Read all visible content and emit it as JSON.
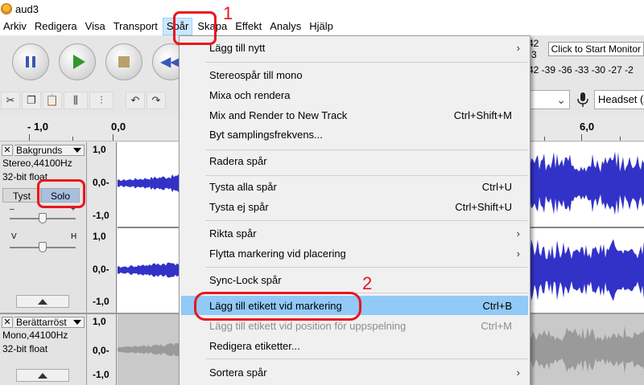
{
  "window": {
    "title": "aud3"
  },
  "menubar": {
    "items": [
      "Arkiv",
      "Redigera",
      "Visa",
      "Transport",
      "Spår",
      "Skapa",
      "Effekt",
      "Analys",
      "Hjälp"
    ]
  },
  "toolbar": {
    "meter_row1": "42 -3",
    "monitor_label": "Click to Start Monitor",
    "meter_row2": "42 -39 -36 -33 -30 -27 -2",
    "playback_device": "Headset (A"
  },
  "ruler": {
    "labels": [
      "- 1,0",
      "0,0",
      "6,0"
    ]
  },
  "tracks": [
    {
      "name": "Bakgrunds",
      "info_line1": "Stereo,44100Hz",
      "info_line2": "32-bit float",
      "mute_label": "Tyst",
      "solo_label": "Solo",
      "gain_minus": "–",
      "gain_plus": "+",
      "pan_left": "V",
      "pan_right": "H",
      "scale_top": "1,0",
      "scale_mid": "0,0-",
      "scale_bottom": "-1,0",
      "scale2_top": "1,0",
      "scale2_mid": "0,0-",
      "scale2_bottom": "-1,0"
    },
    {
      "name": "Berättarröst",
      "info_line1": "Mono,44100Hz",
      "info_line2": "32-bit float",
      "scale_top": "1,0",
      "scale_mid": "0,0-",
      "scale_bottom": "-1,0"
    }
  ],
  "dropdown": {
    "items": [
      {
        "label": "Lägg till nytt",
        "shortcut": "",
        "submenu": true
      },
      {
        "label": "Stereospår till mono",
        "shortcut": ""
      },
      {
        "label": "Mixa och rendera",
        "shortcut": ""
      },
      {
        "label": "Mix and Render to New Track",
        "shortcut": "Ctrl+Shift+M"
      },
      {
        "label": "Byt samplingsfrekvens...",
        "shortcut": ""
      },
      {
        "label": "Radera spår",
        "shortcut": ""
      },
      {
        "label": "Tysta alla spår",
        "shortcut": "Ctrl+U"
      },
      {
        "label": "Tysta ej spår",
        "shortcut": "Ctrl+Shift+U"
      },
      {
        "label": "Rikta spår",
        "shortcut": "",
        "submenu": true
      },
      {
        "label": "Flytta markering vid placering",
        "shortcut": "",
        "submenu": true
      },
      {
        "label": "Sync-Lock spår",
        "shortcut": ""
      },
      {
        "label": "Lägg till etikett vid markering",
        "shortcut": "Ctrl+B"
      },
      {
        "label": "Lägg till etikett vid position för uppspelning",
        "shortcut": "Ctrl+M",
        "disabled": true
      },
      {
        "label": "Redigera etiketter...",
        "shortcut": ""
      },
      {
        "label": "Sortera spår",
        "shortcut": "",
        "submenu": true
      }
    ]
  },
  "annotations": {
    "step1": "1",
    "step2": "2"
  },
  "colors": {
    "waveform": "#3232c8",
    "highlight": "#91c9f7",
    "annotation": "#e8161f",
    "menu_active": "#cce8ff"
  }
}
